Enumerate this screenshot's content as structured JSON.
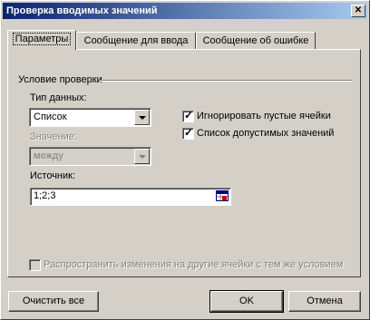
{
  "window": {
    "title": "Проверка вводимых значений",
    "close_glyph": "✕"
  },
  "tabs": [
    {
      "label": "Параметры",
      "active": true
    },
    {
      "label": "Сообщение для ввода",
      "active": false
    },
    {
      "label": "Сообщение об ошибке",
      "active": false
    }
  ],
  "validation": {
    "group_label": "Условие проверки",
    "data_type_label": "Тип данных:",
    "data_type_value": "Список",
    "ignore_blank_label": "Игнорировать пустые ячейки",
    "ignore_blank_checked": true,
    "dropdown_label": "Список допустимых значений",
    "dropdown_checked": true,
    "operator_label": "Значение:",
    "operator_value": "между",
    "source_label": "Источник:",
    "source_value": "1;2;3",
    "apply_all_label": "Распространить изменения на другие ячейки с тем же условием",
    "apply_all_checked": false
  },
  "buttons": {
    "clear_all": "Очистить все",
    "ok": "OK",
    "cancel": "Отмена"
  },
  "icons": {
    "close": "close-icon",
    "dropdown": "chevron-down-icon",
    "range": "range-select-icon",
    "check": "checkmark-icon"
  }
}
